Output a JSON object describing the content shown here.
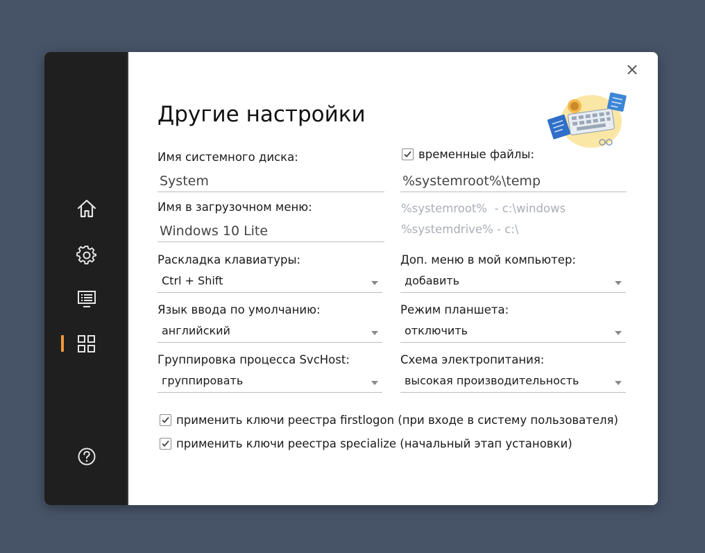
{
  "window": {
    "title": "Другие настройки",
    "close_label": "×"
  },
  "sidebar": {
    "items": [
      {
        "icon": "home-icon",
        "active": false
      },
      {
        "icon": "gear-icon",
        "active": false
      },
      {
        "icon": "monitor-icon",
        "active": false
      },
      {
        "icon": "grid-icon",
        "active": true
      },
      {
        "icon": "help-icon",
        "active": false
      }
    ],
    "accent_color": "#f39a3a"
  },
  "left": {
    "system_disk": {
      "label": "Имя системного диска:",
      "value": "System"
    },
    "boot_menu": {
      "label": "Имя в загрузочном меню:",
      "value": "Windows 10 Lite"
    },
    "keyboard_layout": {
      "label": "Раскладка клавиатуры:",
      "value": "Ctrl + Shift"
    },
    "input_language": {
      "label": "Язык ввода по умолчанию:",
      "value": "английский"
    },
    "svchost_grouping": {
      "label": "Группировка процесса SvcHost:",
      "value": "группировать"
    }
  },
  "right": {
    "temp_files": {
      "label": "временные файлы:",
      "checked": true,
      "value": "%systemroot%\\temp"
    },
    "hints": [
      "%systemroot%  - c:\\windows",
      "%systemdrive% - c:\\"
    ],
    "my_computer_menu": {
      "label": "Доп. меню в мой компьютер:",
      "value": "добавить"
    },
    "tablet_mode": {
      "label": "Режим планшета:",
      "value": "отключить"
    },
    "power_scheme": {
      "label": "Схема электропитания:",
      "value": "высокая производительность"
    }
  },
  "checkboxes": [
    {
      "label": "применить ключи реестра firstlogon (при входе в систему пользователя)",
      "checked": true
    },
    {
      "label": "применить ключи реестра specialize (начальный этап установки)",
      "checked": true
    }
  ]
}
